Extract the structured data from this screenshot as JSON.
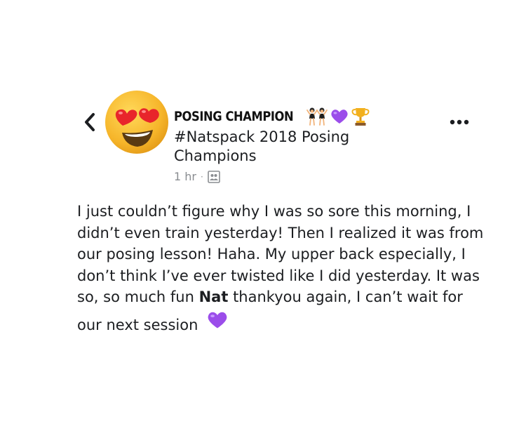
{
  "header": {
    "back_icon": "chevron-left-icon",
    "author_name": "POSING CHAMPION",
    "author_emojis": [
      "dancers-icon",
      "purple-heart-icon",
      "trophy-icon"
    ],
    "group_name": "#Natspack 2018 Posing Champions",
    "timestamp": "1 hr",
    "separator": "·",
    "audience_icon": "group-audience-icon",
    "more_icon": "more-options-icon",
    "avatar_icon": "heart-eyes-emoji-icon"
  },
  "post": {
    "lines": [
      "I just couldn’t figure why I was so sore this morning, I",
      "didn’t even train yesterday! Then I realized it was from",
      "our posing lesson! Haha. My upper back especially, I",
      "don’t think I’ve ever twisted like I did yesterday. It was"
    ],
    "line5_before": "so, so much fun ",
    "line5_mention": "Nat",
    "line5_after": " thankyou again, I can’t wait for",
    "line6": "our next session",
    "trailing_emoji": "purple-heart-icon"
  },
  "colors": {
    "purple_heart": "#9b4dea",
    "meta_gray": "#8a8d91",
    "text": "#1c1e21",
    "emoji_face": "#f7b72a",
    "emoji_heart": "#e8252b"
  }
}
